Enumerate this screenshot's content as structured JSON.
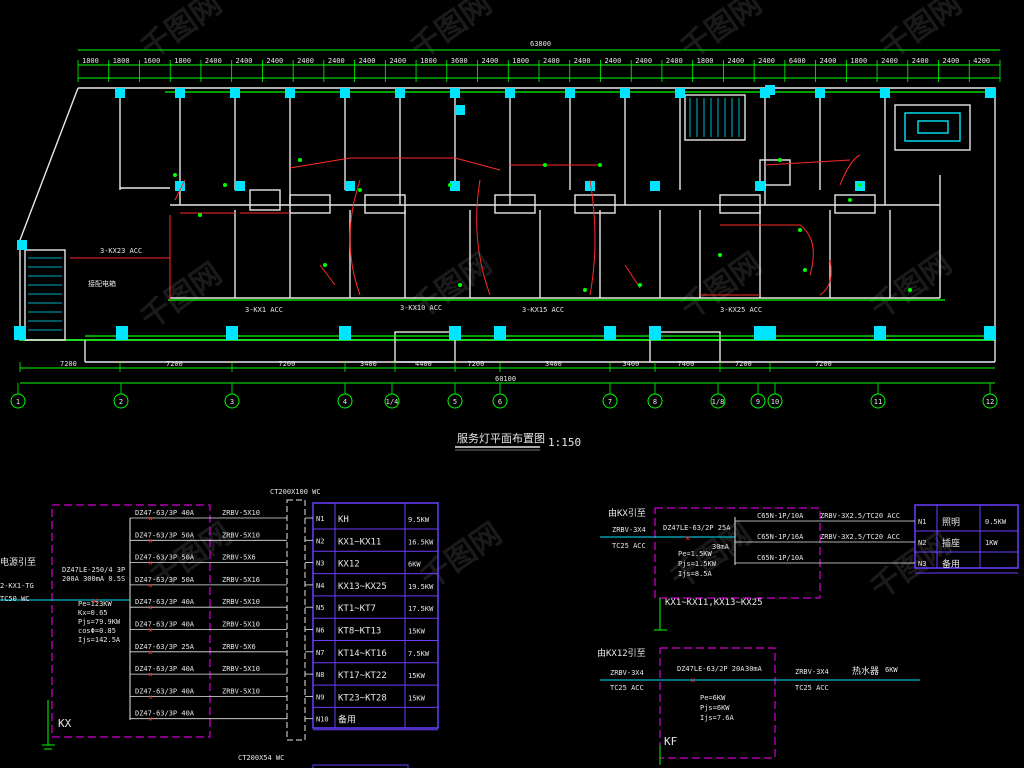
{
  "plan": {
    "overall_dim": "63800",
    "bottom_overall_dim": "60100",
    "scale": "1:150",
    "title": "服务灯平面布置图",
    "top_dims": [
      "1800",
      "1800",
      "1600",
      "1800",
      "2400",
      "2400",
      "2400",
      "2400",
      "2400",
      "2400",
      "2400",
      "1800",
      "3600",
      "2400",
      "1800",
      "2400",
      "2400",
      "2400",
      "2400",
      "2400",
      "1800",
      "2400",
      "2400",
      "6400",
      "2400",
      "1800",
      "2400",
      "2400",
      "2400",
      "4200"
    ],
    "bottom_dims": [
      "7200",
      "7200",
      "7200",
      "3400",
      "4400",
      "7200",
      "3400",
      "3400",
      "7400",
      "7200",
      "7200"
    ],
    "axes": [
      "1",
      "2",
      "3",
      "4",
      "1/4",
      "5",
      "6",
      "7",
      "8",
      "1/8",
      "9",
      "10",
      "11",
      "12"
    ],
    "circuit_labels": [
      "3-KX1 ACC",
      "3-KX10 ACC",
      "3-KX15 ACC",
      "3-KX25 ACC",
      "3-KX23 ACC"
    ],
    "riser_label": "接配电箱"
  },
  "panel_left": {
    "box_code": "KX",
    "incoming_label": "电源引至",
    "incoming_cable": "2-KX1-TG",
    "incoming_pipe": "TC50 WC",
    "main_breaker": "DZ47LE-250/4 3P",
    "main_rating": "200A 300mA 0.5S",
    "params": [
      "Pe=123KW",
      "Kx=0.65",
      "Pjs=79.9KW",
      "cosΦ=0.85",
      "Ijs=142.5A"
    ],
    "tray_label": "CT200X100 WC",
    "bottom_tray_label": "CT200X54 WC",
    "circuits": [
      {
        "breaker": "DZ47-63/3P 40A",
        "cable": "ZRBV-5X10",
        "no": "N1",
        "load": "KH",
        "power": "9.5KW"
      },
      {
        "breaker": "DZ47-63/3P 50A",
        "cable": "ZRBV-5X10",
        "no": "N2",
        "load": "KX1~KX11",
        "power": "16.5KW"
      },
      {
        "breaker": "DZ47-63/3P 50A",
        "cable": "ZRBV-5X6",
        "no": "N3",
        "load": "KX12",
        "power": "6KW"
      },
      {
        "breaker": "DZ47-63/3P 50A",
        "cable": "ZRBV-5X16",
        "no": "N4",
        "load": "KX13~KX25",
        "power": "19.5KW"
      },
      {
        "breaker": "DZ47-63/3P 40A",
        "cable": "ZRBV-5X10",
        "no": "N5",
        "load": "KT1~KT7",
        "power": "17.5KW"
      },
      {
        "breaker": "DZ47-63/3P 40A",
        "cable": "ZRBV-5X10",
        "no": "N6",
        "load": "KT8~KT13",
        "power": "15KW"
      },
      {
        "breaker": "DZ47-63/3P 25A",
        "cable": "ZRBV-5X6",
        "no": "N7",
        "load": "KT14~KT16",
        "power": "7.5KW"
      },
      {
        "breaker": "DZ47-63/3P 40A",
        "cable": "ZRBV-5X10",
        "no": "N8",
        "load": "KT17~KT22",
        "power": "15KW"
      },
      {
        "breaker": "DZ47-63/3P 40A",
        "cable": "ZRBV-5X10",
        "no": "N9",
        "load": "KT23~KT28",
        "power": "15KW"
      },
      {
        "breaker": "DZ47-63/3P 40A",
        "cable": "",
        "no": "N10",
        "load": "备用",
        "power": ""
      }
    ]
  },
  "panel_kx": {
    "incoming_label": "由KX引至",
    "cable": "ZRBV-3X4",
    "pipe": "TC25 ACC",
    "main_breaker": "DZ47LE-63/2P 25A",
    "rcd": "30mA",
    "params": [
      "Pe=1.5KW",
      "Pjs=1.5KW",
      "Ijs=8.5A"
    ],
    "caption": "KX1~KX11,KX13~KX25",
    "circuits": [
      {
        "breaker": "C65N-1P/10A",
        "cable": "ZRBV-3X2.5",
        "pipe": "/TC20 ACC",
        "no": "N1",
        "load": "照明",
        "power": "0.5KW"
      },
      {
        "breaker": "C65N-1P/16A",
        "cable": "ZRBV-3X2.5",
        "pipe": "/TC20 ACC",
        "no": "N2",
        "load": "插座",
        "power": "1KW"
      },
      {
        "breaker": "C65N-1P/10A",
        "cable": "",
        "pipe": "",
        "no": "N3",
        "load": "备用",
        "power": ""
      }
    ]
  },
  "panel_kf": {
    "box_code": "KF",
    "incoming_label": "由KX12引至",
    "cable": "ZRBV-3X4",
    "pipe": "TC25 ACC",
    "main_breaker": "DZ47LE-63/2P 20A",
    "rcd": "30mA",
    "out_cable": "ZRBV-3X4",
    "out_pipe": "TC25 ACC",
    "load": "热水器",
    "power": "6KW",
    "params": [
      "Pe=6KW",
      "Pjs=6KW",
      "Ijs=7.6A"
    ]
  },
  "watermark": "千图网",
  "colors": {
    "wall": "#e8e8e8",
    "dim": "#00ff00",
    "column": "#00e5ff",
    "circuit": "#ff2a2a",
    "panel_border": "#ff00ff",
    "table": "#6a3dff",
    "accent": "#ffff00"
  }
}
